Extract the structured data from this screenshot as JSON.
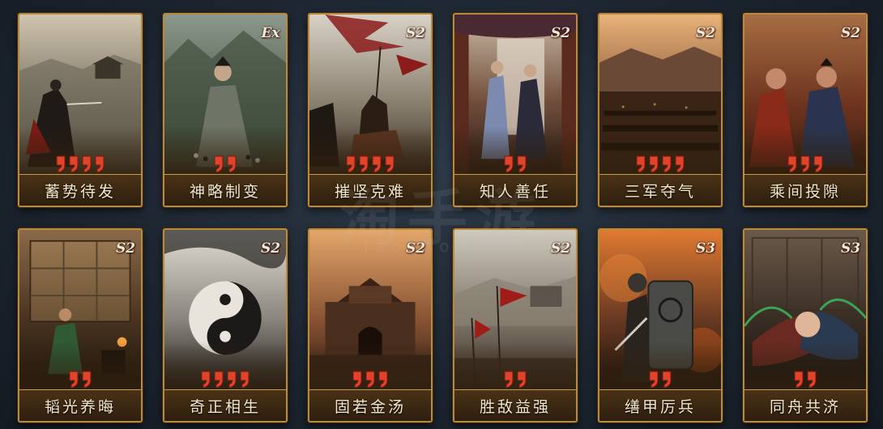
{
  "cards": [
    {
      "name": "蓄势待发",
      "season": "",
      "quality": 4,
      "scene": "general-fortress",
      "palette": [
        "#cfc4ae",
        "#7c7566",
        "#3b3024"
      ]
    },
    {
      "name": "神略制变",
      "season": "Ex",
      "quality": 2,
      "scene": "strategist-go",
      "palette": [
        "#8c988c",
        "#53604f",
        "#2a2b22"
      ]
    },
    {
      "name": "摧坚克难",
      "season": "S2",
      "quality": 4,
      "scene": "cavalry-banners",
      "palette": [
        "#d8d2c6",
        "#8a8070",
        "#3a2e22"
      ]
    },
    {
      "name": "知人善任",
      "season": "S2",
      "quality": 2,
      "scene": "hall-officials",
      "palette": [
        "#c9b9a4",
        "#6f4d3a",
        "#2c1d16"
      ]
    },
    {
      "name": "三军夺气",
      "season": "S2",
      "quality": 4,
      "scene": "army-plain",
      "palette": [
        "#e8b27a",
        "#8a5a3a",
        "#2b1a10"
      ]
    },
    {
      "name": "乘间投隙",
      "season": "S2",
      "quality": 3,
      "scene": "whispering-lords",
      "palette": [
        "#c78a58",
        "#7a3a22",
        "#2a1610"
      ]
    },
    {
      "name": "韬光养晦",
      "season": "S2",
      "quality": 2,
      "scene": "sage-room",
      "palette": [
        "#8a6a48",
        "#4a3420",
        "#1e150c"
      ]
    },
    {
      "name": "奇正相生",
      "season": "S2",
      "quality": 4,
      "scene": "taiji",
      "palette": [
        "#e2ddd2",
        "#8a8680",
        "#24221f"
      ]
    },
    {
      "name": "固若金汤",
      "season": "S2",
      "quality": 3,
      "scene": "city-gate",
      "palette": [
        "#e3a66a",
        "#8a5434",
        "#2e1c12"
      ]
    },
    {
      "name": "胜敌益强",
      "season": "S2",
      "quality": 2,
      "scene": "battlefield-flags",
      "palette": [
        "#cfcabd",
        "#80776a",
        "#3a2e24"
      ]
    },
    {
      "name": "缮甲厉兵",
      "season": "S3",
      "quality": 2,
      "scene": "armored-shield",
      "palette": [
        "#e07a32",
        "#6a3a22",
        "#1c120c"
      ]
    },
    {
      "name": "同舟共济",
      "season": "S3",
      "quality": 2,
      "scene": "clasped-hands",
      "palette": [
        "#6a5a4a",
        "#3a2e24",
        "#161210"
      ]
    }
  ],
  "watermark": "淘手游",
  "watermark_sub": "Taoshouyou",
  "colors": {
    "frame": "#b8893f",
    "pip": "#e0442a",
    "name_text": "#f3e6c8"
  },
  "icons": {
    "quality_pip": "quality-pip-icon",
    "season_badge": "season-badge-icon"
  }
}
